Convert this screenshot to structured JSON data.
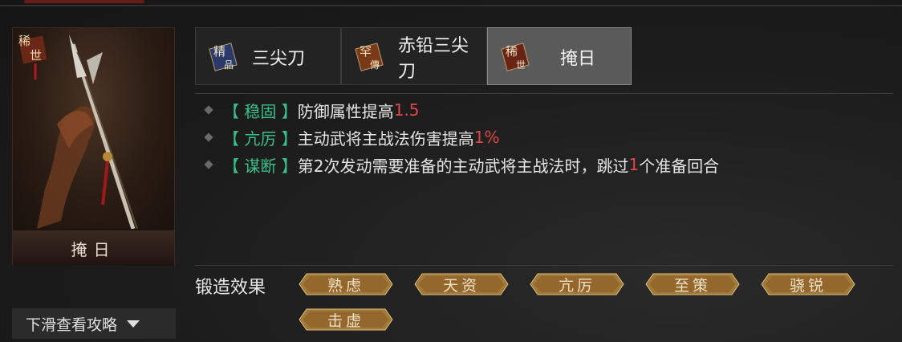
{
  "item_card": {
    "rarity_badge": [
      "稀",
      "世"
    ],
    "name": "掩日"
  },
  "tabs": [
    {
      "badge": [
        "精",
        "品"
      ],
      "badge_color": "#2a3a6a",
      "label": "三尖刀",
      "active": false
    },
    {
      "badge": [
        "罕",
        "傳"
      ],
      "badge_color": "#7a3a18",
      "label": "赤铅三尖刀",
      "active": false
    },
    {
      "badge": [
        "稀",
        "世"
      ],
      "badge_color": "#6a2416",
      "label": "掩日",
      "active": true
    }
  ],
  "effects": [
    {
      "name": "【 稳固 】",
      "before": "防御属性提高",
      "value": "1.5",
      "after": ""
    },
    {
      "name": "【 亢厉 】",
      "before": "主动武将主战法伤害提高",
      "value": "1%",
      "after": ""
    },
    {
      "name": "【 谋断 】",
      "before": "第2次发动需要准备的主动武将主战法时，跳过",
      "value": "1",
      "after": "个准备回合"
    }
  ],
  "forge": {
    "label": "锻造效果",
    "tags": [
      "熟虑",
      "天资",
      "亢厉",
      "至策",
      "骁锐",
      "击虚"
    ]
  },
  "scroll_hint": {
    "label": "下滑查看攻略",
    "icon": "caret-down-icon"
  },
  "colors": {
    "effect_name": "#39c08a",
    "highlight": "#e04848",
    "tag_fill": "#a07838"
  }
}
